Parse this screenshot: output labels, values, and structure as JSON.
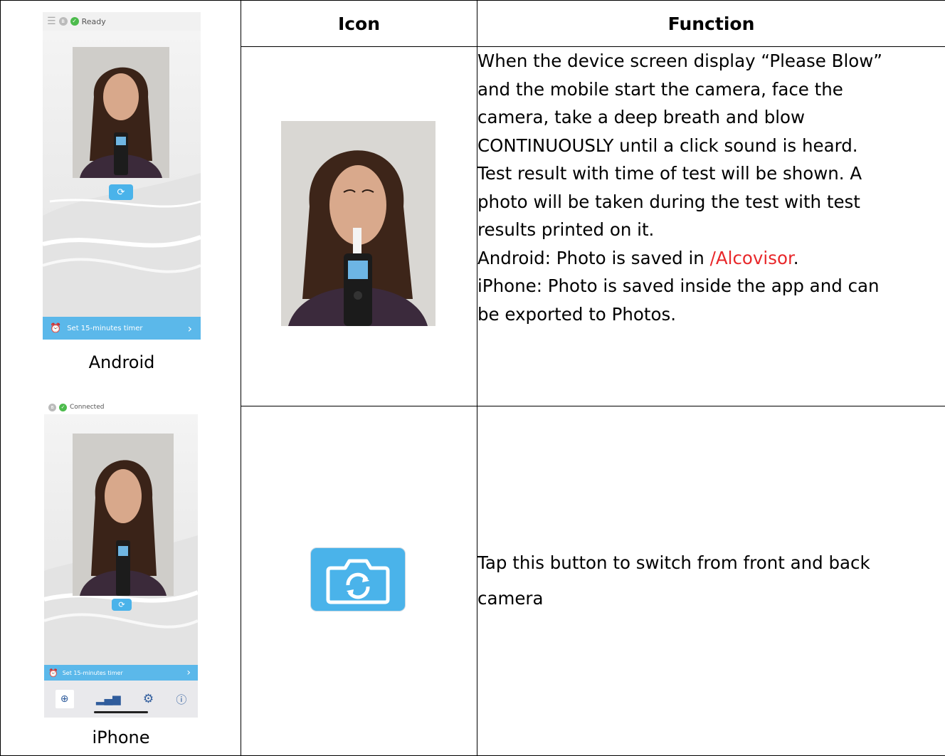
{
  "table": {
    "header_icon": "Icon",
    "header_function": "Function"
  },
  "android": {
    "status_text": "Ready",
    "timer_label": "Set 15-minutes timer",
    "caption": "Android"
  },
  "iphone": {
    "status_text": "Connected",
    "timer_label": "Set 15-minutes timer",
    "caption": "iPhone"
  },
  "row1": {
    "line1": "When the device screen display “Please Blow”",
    "line2": "and the mobile start the camera, face the",
    "line3": "camera, take a deep breath and blow",
    "line4": "CONTINUOUSLY until a click sound is heard.",
    "line5": "Test result with time of test will be shown.    A",
    "line6": "photo will be taken during the test with test",
    "line7": "results printed on it.",
    "android_prefix": "Android: Photo is saved in ",
    "android_path": "/Alcovisor",
    "android_suffix": ".",
    "iphone_line1": "iPhone: Photo is saved inside the app and can",
    "iphone_line2": "be exported to Photos."
  },
  "row2": {
    "line1": "Tap this button to switch from front and back",
    "line2": "camera"
  },
  "colors": {
    "accent_blue": "#4ab3ea",
    "path_red": "#e8272a"
  }
}
